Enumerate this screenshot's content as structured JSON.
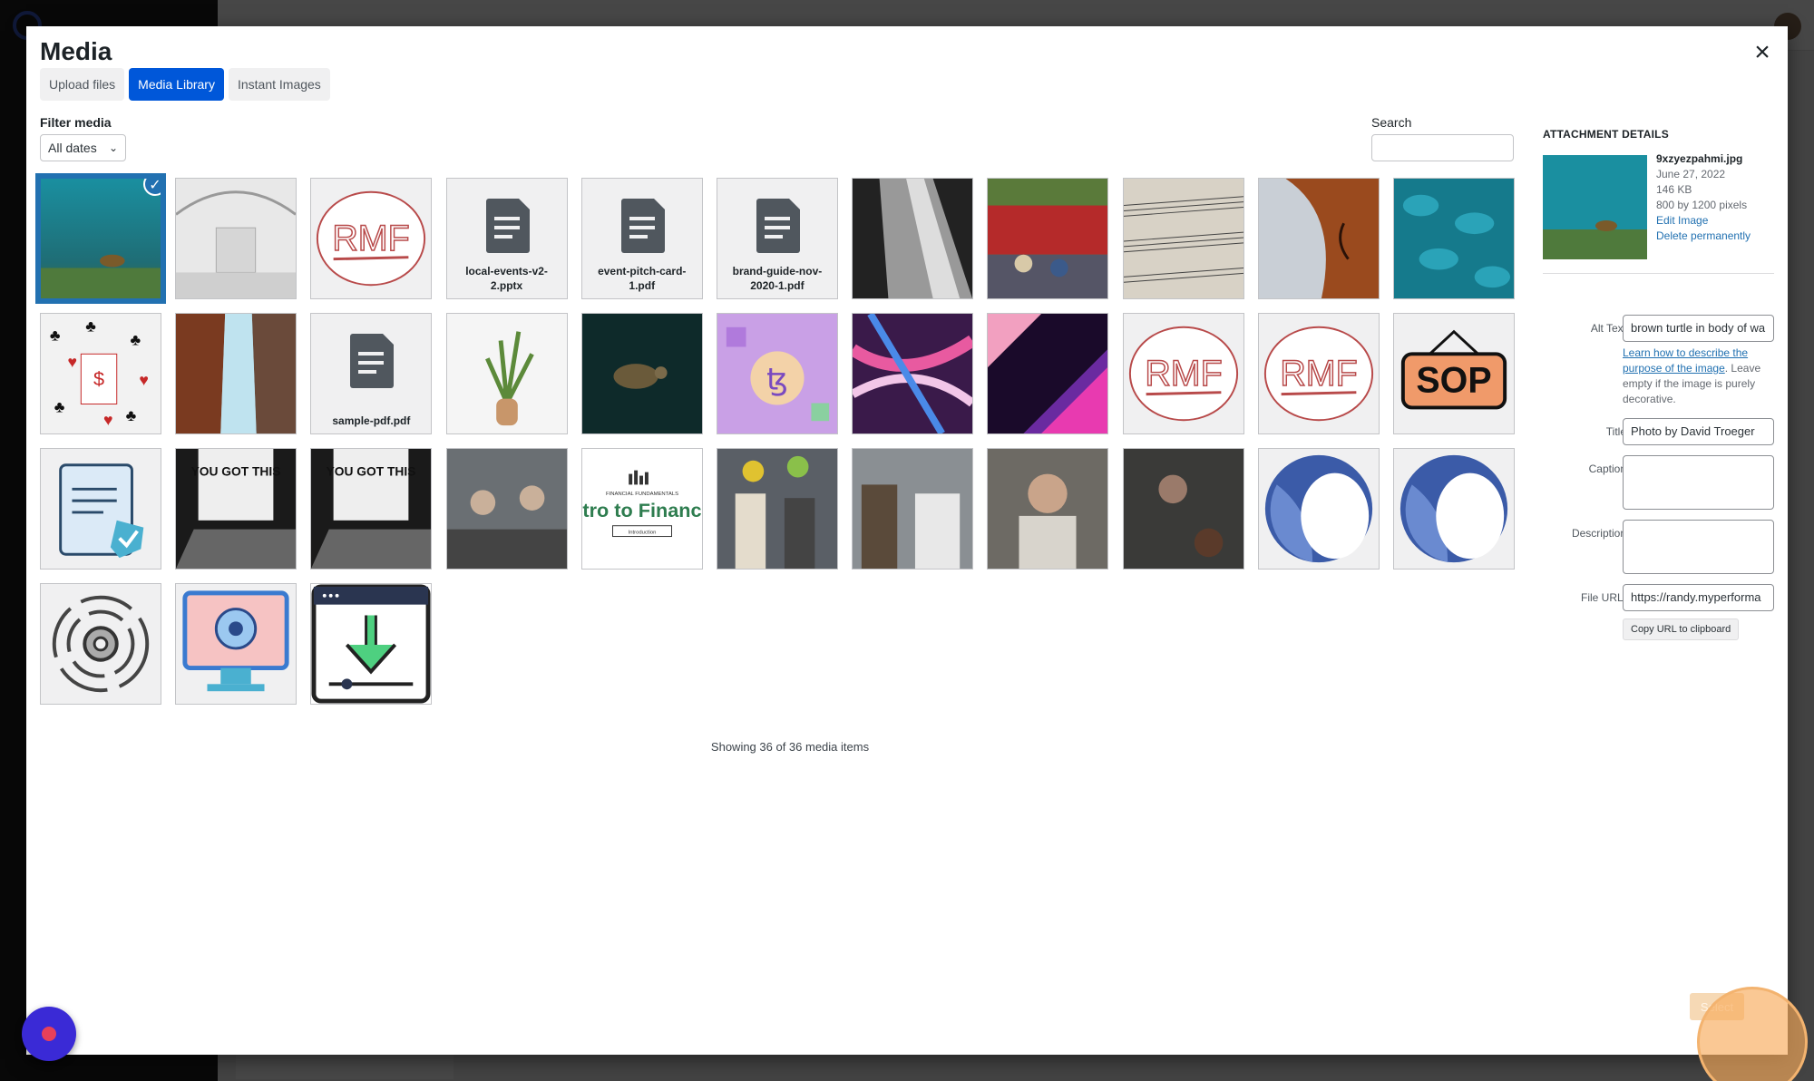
{
  "modal": {
    "title": "Media",
    "tabs": [
      {
        "label": "Upload files",
        "active": false
      },
      {
        "label": "Media Library",
        "active": true
      },
      {
        "label": "Instant Images",
        "active": false
      }
    ],
    "filter_label": "Filter media",
    "date_filter_value": "All dates",
    "search_label": "Search",
    "search_value": "",
    "showing_text": "Showing 36 of 36 media items",
    "select_button": "Select"
  },
  "media_items": [
    {
      "kind": "photo",
      "name": "9xzyezpahmi.jpg",
      "selected": true
    },
    {
      "kind": "photo"
    },
    {
      "kind": "logo",
      "text": "RMF"
    },
    {
      "kind": "doc",
      "name": "local-events-v2-2.pptx"
    },
    {
      "kind": "doc",
      "name": "event-pitch-card-1.pdf"
    },
    {
      "kind": "doc",
      "name": "brand-guide-nov-2020-1.pdf"
    },
    {
      "kind": "photo"
    },
    {
      "kind": "photo"
    },
    {
      "kind": "photo"
    },
    {
      "kind": "photo"
    },
    {
      "kind": "photo"
    },
    {
      "kind": "photo"
    },
    {
      "kind": "photo"
    },
    {
      "kind": "doc",
      "name": "sample-pdf.pdf"
    },
    {
      "kind": "photo"
    },
    {
      "kind": "photo"
    },
    {
      "kind": "illustration"
    },
    {
      "kind": "photo"
    },
    {
      "kind": "photo"
    },
    {
      "kind": "logo",
      "text": "RMF"
    },
    {
      "kind": "logo",
      "text": "RMF"
    },
    {
      "kind": "illustration",
      "text": "SOP"
    },
    {
      "kind": "illustration"
    },
    {
      "kind": "photo",
      "text": "YOU GOT THIS"
    },
    {
      "kind": "photo",
      "text": "YOU GOT THIS"
    },
    {
      "kind": "photo"
    },
    {
      "kind": "slide",
      "brand": "FINANCIAL FUNDAMENTALS",
      "headline": "tro to Financ",
      "button": "Introduction"
    },
    {
      "kind": "photo"
    },
    {
      "kind": "photo"
    },
    {
      "kind": "photo"
    },
    {
      "kind": "photo"
    },
    {
      "kind": "logo"
    },
    {
      "kind": "logo"
    },
    {
      "kind": "illustration"
    },
    {
      "kind": "illustration"
    },
    {
      "kind": "illustration"
    }
  ],
  "details": {
    "heading": "ATTACHMENT DETAILS",
    "filename": "9xzyezpahmi.jpg",
    "date": "June 27, 2022",
    "size": "146 KB",
    "dimensions": "800 by 1200 pixels",
    "edit_link": "Edit Image",
    "delete_link": "Delete permanently",
    "alt_label": "Alt Text",
    "alt_value": "brown turtle in body of wa",
    "help_link": "Learn how to describe the purpose of the image",
    "help_text": ". Leave empty if the image is purely decorative.",
    "title_label": "Title",
    "title_value": "Photo by David Troeger",
    "caption_label": "Caption",
    "caption_value": "",
    "description_label": "Description",
    "description_value": "",
    "url_label": "File URL:",
    "url_value": "https://randy.myperforma",
    "copy_button": "Copy URL to clipboard"
  },
  "colors": {
    "accent": "#0057d9",
    "selection": "#2271b1",
    "highlight": "#f3b36f"
  }
}
